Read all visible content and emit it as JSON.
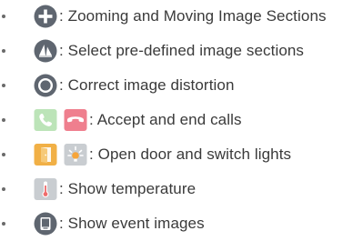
{
  "items": [
    {
      "icons": [
        "zoom-move-icon"
      ],
      "text": ": Zooming and Moving Image Sections"
    },
    {
      "icons": [
        "preset-sections-icon"
      ],
      "text": ": Select pre-defined image sections"
    },
    {
      "icons": [
        "distortion-correction-icon"
      ],
      "text": ": Correct image distortion"
    },
    {
      "icons": [
        "accept-call-icon",
        "end-call-icon"
      ],
      "text": ": Accept and end calls"
    },
    {
      "icons": [
        "door-open-icon",
        "light-switch-icon"
      ],
      "text": ": Open door and switch lights"
    },
    {
      "icons": [
        "thermometer-icon"
      ],
      "text": ": Show temperature"
    },
    {
      "icons": [
        "event-images-icon"
      ],
      "text": ": Show event images"
    }
  ],
  "colors": {
    "icon_dark": "#5f6670",
    "accept_green": "#8fd08a",
    "end_red": "#ef7f8e",
    "door_orange": "#f1b046",
    "light_gray": "#c9cdd1",
    "text": "#3a3a3a"
  }
}
